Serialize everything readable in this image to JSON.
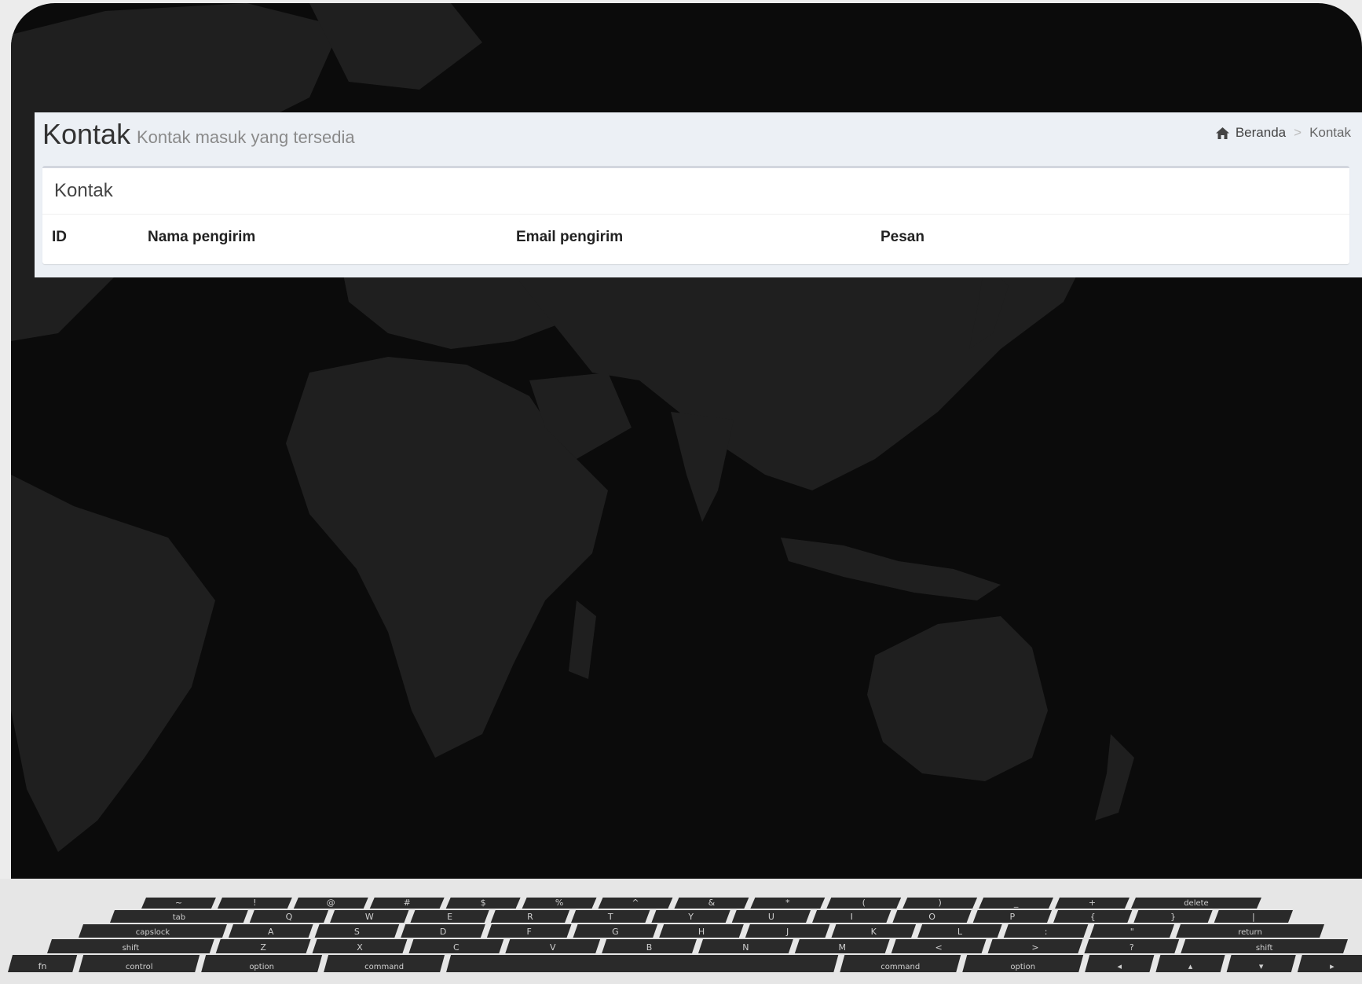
{
  "header": {
    "title": "Kontak",
    "subtitle": "Kontak masuk yang tersedia"
  },
  "breadcrumb": {
    "home_icon": "home-icon",
    "home_label": "Beranda",
    "separator": ">",
    "current": "Kontak"
  },
  "box": {
    "title": "Kontak"
  },
  "table": {
    "columns": [
      "ID",
      "Nama pengirim",
      "Email pengirim",
      "Pesan"
    ],
    "rows": []
  },
  "keyboard": {
    "row1": [
      "~",
      "!",
      "@",
      "#",
      "$",
      "%",
      "^",
      "&",
      "*",
      "(",
      ")",
      "_",
      "+",
      "delete"
    ],
    "row2": [
      "tab",
      "Q",
      "W",
      "E",
      "R",
      "T",
      "Y",
      "U",
      "I",
      "O",
      "P",
      "{",
      "}",
      "|"
    ],
    "row3": [
      "capslock",
      "A",
      "S",
      "D",
      "F",
      "G",
      "H",
      "J",
      "K",
      "L",
      ":",
      "\"",
      "return"
    ],
    "row4": [
      "shift",
      "Z",
      "X",
      "C",
      "V",
      "B",
      "N",
      "M",
      "<",
      ">",
      "?",
      "shift"
    ],
    "row5": [
      "fn",
      "control",
      "option",
      "command",
      "",
      "command",
      "option",
      "◂",
      "▴",
      "▾",
      "▸"
    ]
  },
  "colors": {
    "screen_bg": "#0b0b0b",
    "map_land": "#1f1f1f",
    "app_bg": "#ecf0f5",
    "box_border": "#d2d6de",
    "key_fill": "#2a2a2a",
    "key_text": "#cfcfcf"
  }
}
